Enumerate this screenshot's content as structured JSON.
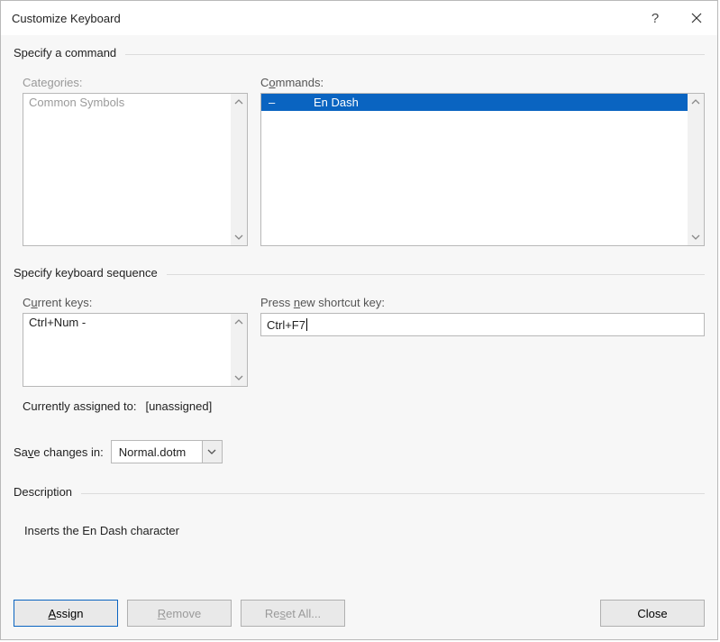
{
  "titlebar": {
    "title": "Customize Keyboard",
    "help_glyph": "?",
    "close_glyph": "✕"
  },
  "sections": {
    "specify_command": "Specify a command",
    "categories_label_pre": "Cate",
    "categories_label_un": "g",
    "categories_label_post": "ories:",
    "commands_label_pre": "C",
    "commands_label_un": "o",
    "commands_label_post": "mmands:",
    "categories_item": "Common Symbols",
    "command_symbol": "–",
    "command_name": "En Dash",
    "specify_keyseq": "Specify keyboard sequence",
    "current_keys_label_pre": "C",
    "current_keys_label_un": "u",
    "current_keys_label_post": "rrent keys:",
    "current_key_value": "Ctrl+Num -",
    "press_new_pre": "Press ",
    "press_new_un": "n",
    "press_new_post": "ew shortcut key:",
    "new_shortcut_value": "Ctrl+F7",
    "assigned_label": "Currently assigned to:",
    "assigned_value": "[unassigned]",
    "save_changes_pre": "Sa",
    "save_changes_un": "v",
    "save_changes_post": "e changes in:",
    "save_target": "Normal.dotm",
    "description_label": "Description",
    "description_text": "Inserts the En Dash character"
  },
  "buttons": {
    "assign_un": "A",
    "assign_post": "ssign",
    "remove_un": "R",
    "remove_post": "emove",
    "reset_pre": "Re",
    "reset_un": "s",
    "reset_post": "et All...",
    "close": "Close"
  }
}
